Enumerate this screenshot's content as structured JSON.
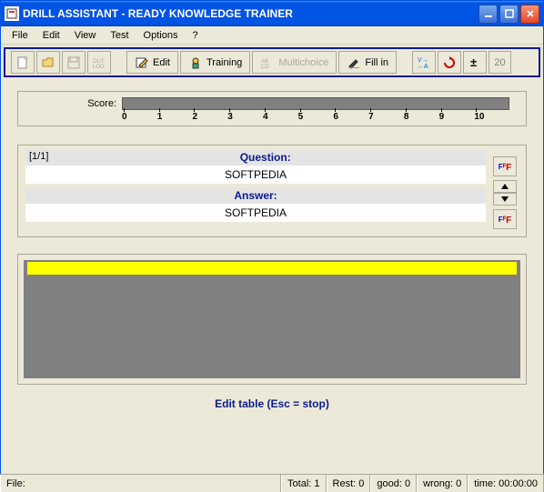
{
  "window": {
    "title": "DRILL ASSISTANT - READY KNOWLEDGE TRAINER",
    "icon_label": "DRILL"
  },
  "menu": {
    "items": [
      "File",
      "Edit",
      "View",
      "Test",
      "Options",
      "?"
    ]
  },
  "toolbar": {
    "edit": "Edit",
    "training": "Training",
    "multichoice": "Multichoice",
    "fillin": "Fill in",
    "spin_value": "20"
  },
  "score": {
    "label": "Score:",
    "ticks": [
      "0",
      "1",
      "2",
      "3",
      "4",
      "5",
      "6",
      "7",
      "8",
      "9",
      "10"
    ]
  },
  "qa": {
    "counter": "[1/1]",
    "question_label": "Question:",
    "question_value": "SOFTPEDIA",
    "answer_label": "Answer:",
    "answer_value": "SOFTPEDIA"
  },
  "hint": "Edit table (Esc = stop)",
  "status": {
    "file_label": "File:",
    "file_value": "",
    "total": "Total: 1",
    "rest": "Rest: 0",
    "good": "good: 0",
    "wrong": "wrong: 0",
    "time": "time: 00:00:00"
  }
}
